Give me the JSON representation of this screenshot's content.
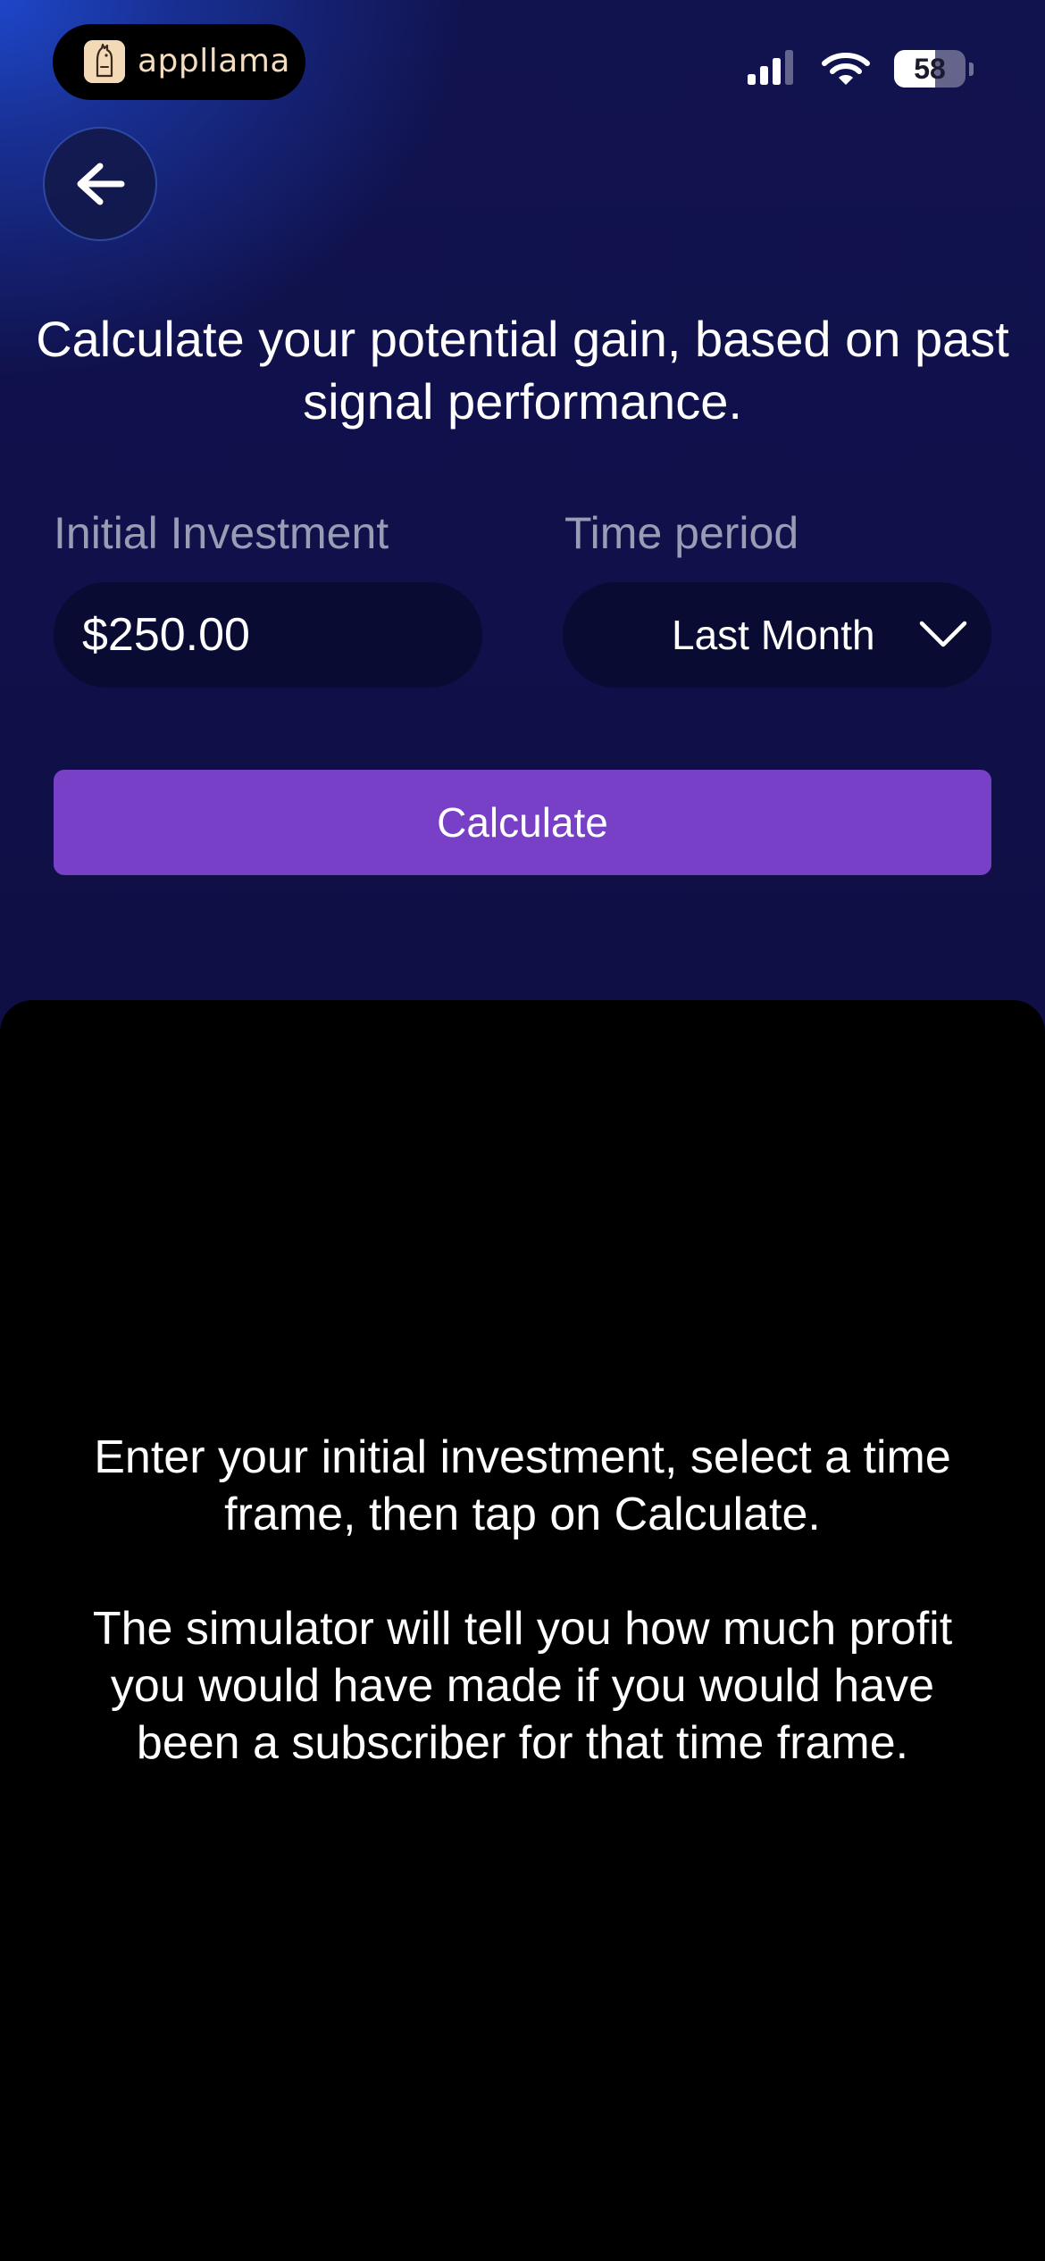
{
  "status_bar": {
    "brand_name": "appllama",
    "battery_level": "58",
    "battery_fraction": 0.58,
    "signal_bars": 4,
    "signal_bars_filled": 3
  },
  "header": {
    "back_icon": "arrow-left-icon",
    "title": "Calculate your potential gain, based on past signal performance."
  },
  "form": {
    "investment_label": "Initial Investment",
    "investment_value": "$250.00",
    "period_label": "Time period",
    "period_value": "Last Month",
    "period_icon": "chevron-down-icon",
    "calculate_label": "Calculate"
  },
  "results": {
    "instruction_line1": "Enter your initial investment, select a time frame, then tap on Calculate.",
    "instruction_line2": "The simulator will tell you how much profit you would have made if you would have been a subscriber for that time frame."
  },
  "colors": {
    "accent": "#7740c6",
    "background_top": "#11134f",
    "field_background": "#0a0b32",
    "label_text": "#9a9bb4",
    "brand_text": "#f3dcc0"
  }
}
